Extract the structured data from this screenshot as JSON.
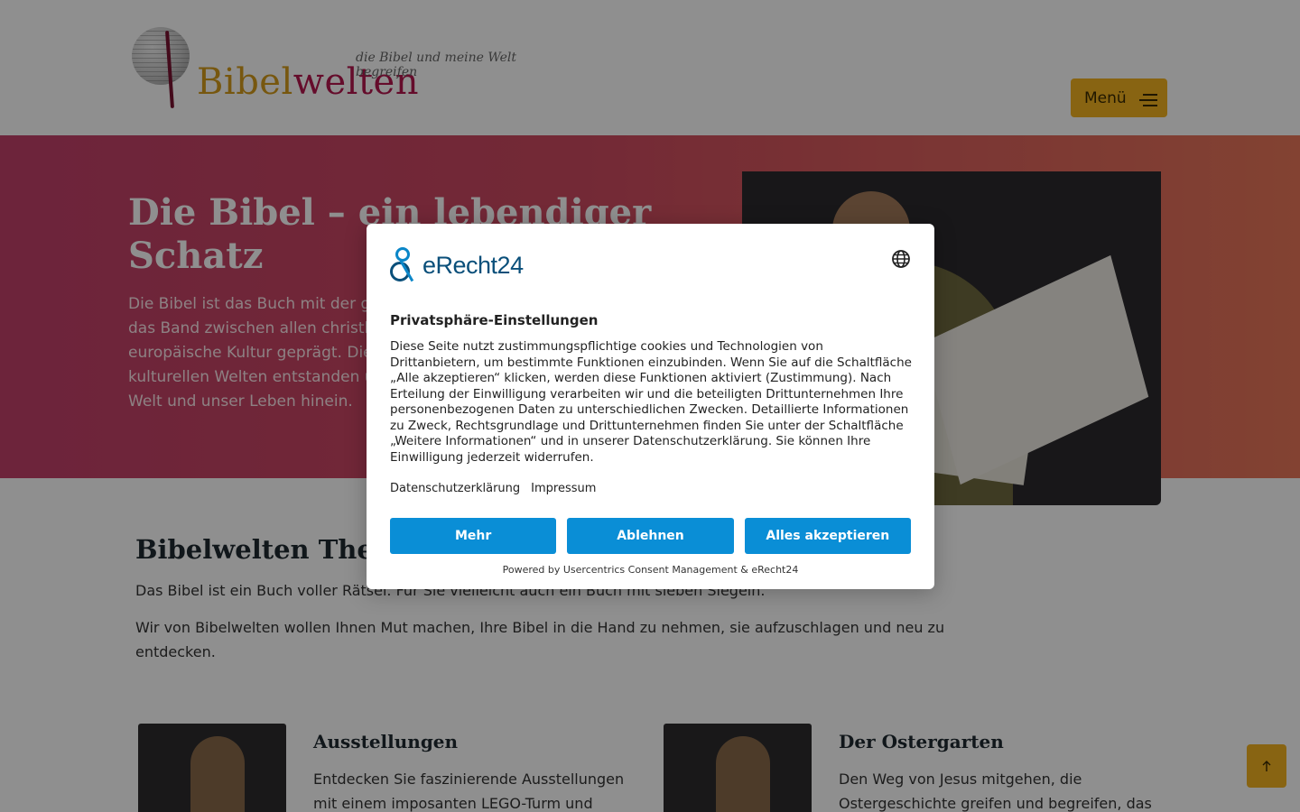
{
  "header": {
    "logo_part1": "Bibel",
    "logo_part2": "welten",
    "tagline": "die Bibel und meine Welt begreifen",
    "menu_label": "Menü"
  },
  "hero": {
    "title": "Die Bibel – ein lebendiger Schatz",
    "text": "Die Bibel ist das Buch mit der gröBten Auflage weltweit. Sie ist das Band zwischen allen christlichen Kirchen und hat die europäische Kultur geprägt. Die Bibel ist in uns heute fremden kulturellen Welten entstanden und spricht doch in unsere eigene Welt und unser Leben hinein."
  },
  "themes": {
    "title": "Bibelwelten Themen",
    "p1": "Das Bibel ist ein Buch voller Rätsel. Für Sie vielleicht auch ein Buch mit sieben Siegeln.",
    "p2": "Wir von Bibelwelten wollen Ihnen Mut machen, Ihre Bibel in die Hand zu nehmen, sie aufzuschlagen und neu zu entdecken.",
    "cards": [
      {
        "title": "Ausstellungen",
        "text": "Entdecken Sie faszinierende Ausstellungen mit einem imposanten LEGO-Turm und"
      },
      {
        "title": "Der Ostergarten",
        "text": "Den Weg von Jesus mitgehen, die Ostergeschichte greifen und begreifen, das"
      }
    ]
  },
  "consent": {
    "brand": "eRecht24",
    "title": "Privatsphäre-Einstellungen",
    "body": "Diese Seite nutzt zustimmungspflichtige cookies und Technologien von Drittanbietern, um bestimmte Funktionen einzubinden. Wenn Sie auf die Schaltfläche „Alle akzeptieren“ klicken, werden diese Funktionen aktiviert (Zustimmung). Nach Erteilung der Einwilligung verarbeiten wir und die beteiligten Drittunternehmen Ihre personenbezogenen Daten zu unterschiedlichen Zwecken. Detaillierte Informationen zu Zweck, Rechtsgrundlage und Drittunternehmen finden Sie unter der Schaltfläche „Weitere Informationen“ und in unserer Datenschutzerklärung. Sie können Ihre Einwilligung jederzeit widerrufen.",
    "link_privacy": "Datenschutzerklärung",
    "link_imprint": "Impressum",
    "btn_more": "Mehr",
    "btn_decline": "Ablehnen",
    "btn_accept": "Alles akzeptieren",
    "powered": "Powered by Usercentrics Consent Management & eRecht24"
  },
  "colors": {
    "accent_yellow": "#f3b320",
    "consent_blue": "#0a8ed6",
    "hero_pink": "#c2406a",
    "hero_orange": "#e9775a"
  },
  "icons": {
    "language": "globe-icon",
    "menu": "hamburger-icon",
    "to_top": "arrow-up-icon"
  }
}
